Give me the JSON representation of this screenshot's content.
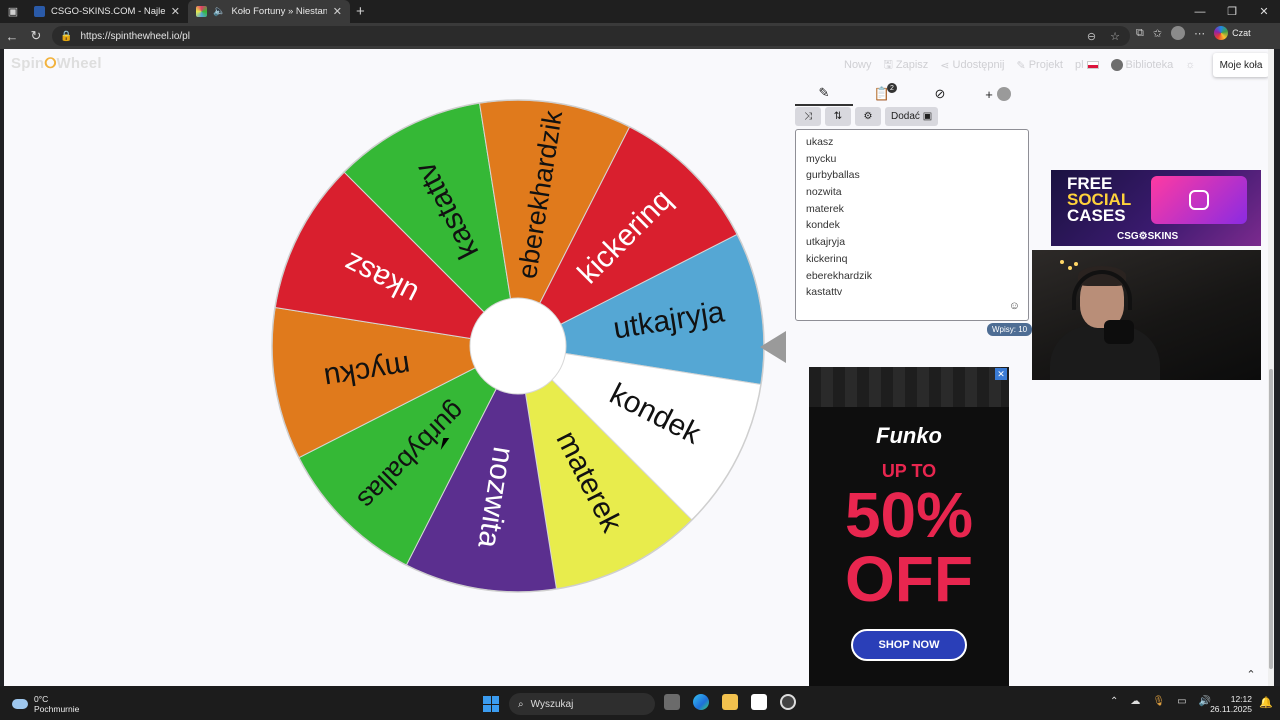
{
  "browser": {
    "tabs": [
      {
        "title": "CSGO-SKINS.COM - Najlepsze Sk",
        "fav_color": "#2a5aa8"
      },
      {
        "title": "Koło Fortuny » Niestandard",
        "fav_color": "#e33b66"
      }
    ],
    "url": "https://spinthewheel.io/pl",
    "copilot_label": "Czat"
  },
  "site": {
    "logo_prefix": "Spin",
    "logo_mid": "⭘",
    "logo_suffix": "Wheel",
    "nav": {
      "nowy": "Nowy",
      "zapisz": "Zapisz",
      "udostepnij": "Udostępnij",
      "projekt": "Projekt",
      "lang": "pl",
      "biblioteka": "Biblioteka"
    },
    "moje_kola": "Moje koła"
  },
  "wheel": {
    "segments": [
      {
        "label": "utkajryja",
        "color": "#55a7d4"
      },
      {
        "label": "kondek",
        "color": "#ffffff"
      },
      {
        "label": "materek",
        "color": "#e8ec4c"
      },
      {
        "label": "nozwita",
        "color": "#5b2f8f"
      },
      {
        "label": "gurbyballas",
        "color": "#35b836"
      },
      {
        "label": "mycku",
        "color": "#e07a1c"
      },
      {
        "label": "ukasz",
        "color": "#d91f2e"
      },
      {
        "label": "kastattv",
        "color": "#35b836"
      },
      {
        "label": "eberekhardzik",
        "color": "#e07a1c"
      },
      {
        "label": "kickerinq",
        "color": "#d91f2e"
      }
    ],
    "text_colors": {
      "#5b2f8f": "#ffffff",
      "#d91f2e": "#ffffff"
    }
  },
  "editor": {
    "add_label": "Dodać",
    "list_badge": "2",
    "entries": [
      "ukasz",
      "mycku",
      "gurbyballas",
      "nozwita",
      "materek",
      "kondek",
      "utkajryja",
      "kickerinq",
      "eberekhardzik",
      "kastattv"
    ],
    "count_label": "Wpisy: 10"
  },
  "ads": {
    "csgo": {
      "line1": "FREE",
      "line2": "SOCIAL",
      "line3": "CASES",
      "brand": "CSG⚙SKINS"
    },
    "funko": {
      "brand": "Funko",
      "upto": "UP TO",
      "percent": "50%",
      "off": "OFF",
      "cta": "SHOP NOW"
    }
  },
  "taskbar": {
    "temp": "0°C",
    "condition": "Pochmurnie",
    "search": "Wyszukaj",
    "time": "12:12",
    "date": "26.11.2025"
  }
}
